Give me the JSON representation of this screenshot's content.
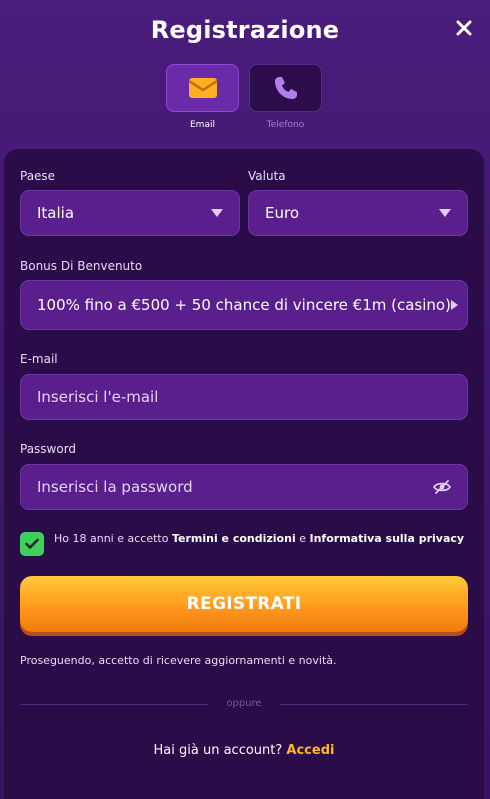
{
  "header": {
    "title": "Registrazione"
  },
  "tabs": [
    {
      "label": "Email",
      "icon": "envelope-icon",
      "active": true
    },
    {
      "label": "Telefono",
      "icon": "phone-icon",
      "active": false
    }
  ],
  "form": {
    "country": {
      "label": "Paese",
      "value": "Italia"
    },
    "currency": {
      "label": "Valuta",
      "value": "Euro"
    },
    "bonus": {
      "label": "Bonus Di Benvenuto",
      "value": "100% fino a €500 + 50 chance di vincere €1m (casino)"
    },
    "email": {
      "label": "E-mail",
      "placeholder": "Inserisci l'e-mail"
    },
    "password": {
      "label": "Password",
      "placeholder": "Inserisci la password"
    },
    "consent": {
      "checked": true,
      "prefix": "Ho 18 anni e accetto ",
      "terms": "Termini e condizioni",
      "middle": " e ",
      "privacy": "Informativa sulla privacy"
    },
    "submit_label": "REGISTRATI",
    "note": "Proseguendo, accetto di ricevere aggiornamenti e novità.",
    "divider": "oppure",
    "account_prompt": "Hai già un account?",
    "login_link": "Accedi"
  },
  "colors": {
    "accent": "#ffb81f",
    "button": "#ff9a1d",
    "checkbox": "#3fcf5d",
    "field": "#5a1f8c",
    "card": "#2a0c48"
  }
}
